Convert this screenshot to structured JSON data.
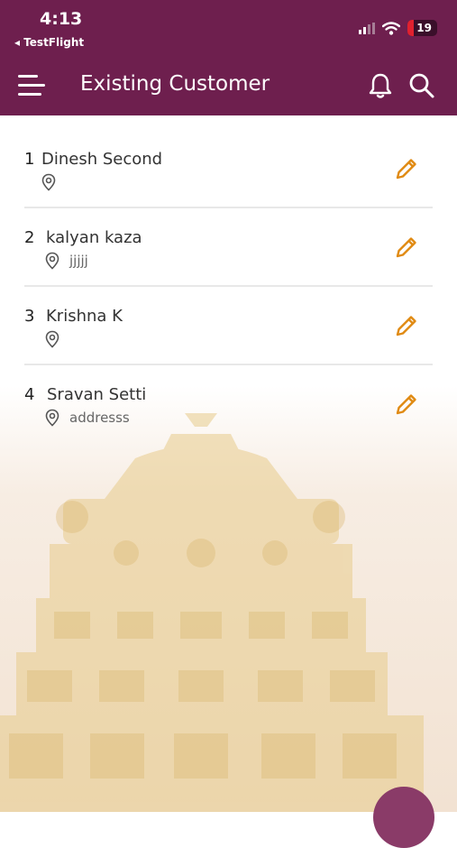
{
  "status_bar": {
    "time": "4:13",
    "back_app": "◂ TestFlight",
    "battery": "19"
  },
  "header": {
    "title": "Existing Customer"
  },
  "customers": [
    {
      "index": "1",
      "name": "Dinesh Second",
      "address": ""
    },
    {
      "index": "2",
      "name": "kalyan kaza",
      "address": "jjjjj"
    },
    {
      "index": "3",
      "name": "Krishna K",
      "address": ""
    },
    {
      "index": "4",
      "name": "Sravan Setti",
      "address": "addresss"
    }
  ],
  "colors": {
    "brand": "#6e1f4e",
    "edit_accent": "#e08a12"
  },
  "icons": {
    "menu": "hamburger-menu-icon",
    "notification": "bell-icon",
    "search": "search-icon",
    "location": "location-pin-icon",
    "edit": "pencil-icon"
  }
}
